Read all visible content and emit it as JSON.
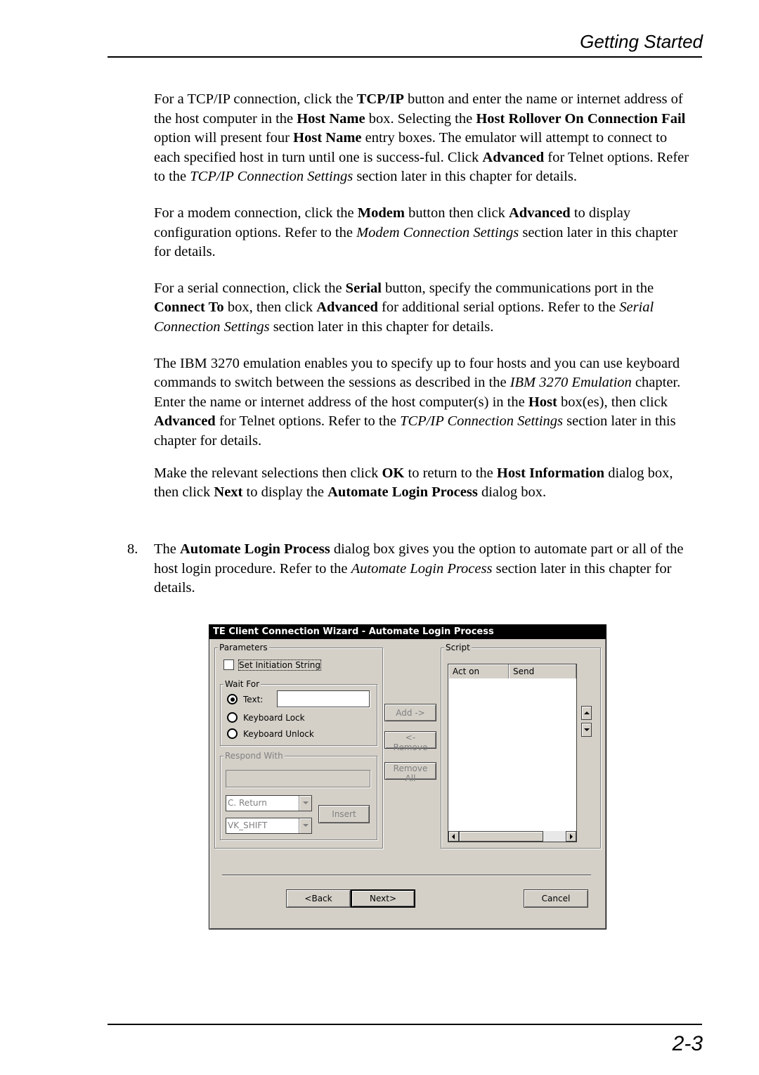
{
  "header": {
    "running_head": "Getting Started"
  },
  "paragraphs": [
    [
      "For a TCP/IP connection, click the ",
      {
        "b": "TCP/IP"
      },
      " button and enter the name or internet address of the host computer in the ",
      {
        "b": "Host Name"
      },
      " box. Selecting the ",
      {
        "b": "Host Rollover On Connection Fail"
      },
      " option will present four ",
      {
        "b": "Host Name"
      },
      " entry boxes. The emulator will attempt to connect to each specified host in turn until one is success-ful. Click ",
      {
        "b": "Advanced"
      },
      " for Telnet options. Refer to the ",
      {
        "i": "TCP/IP Connection Settings"
      },
      " section later in this chapter for details."
    ],
    [
      "For a modem connection, click the ",
      {
        "b": "Modem"
      },
      " button then click ",
      {
        "b": "Advanced"
      },
      " to display configuration options. Refer to the ",
      {
        "i": "Modem Connection Settings"
      },
      " section later in this chapter for details."
    ],
    [
      "For a serial connection, click the ",
      {
        "b": "Serial"
      },
      " button, specify the communications port in the ",
      {
        "b": "Connect To"
      },
      " box, then click ",
      {
        "b": "Advanced"
      },
      " for additional serial options. Refer to the ",
      {
        "i": "Serial Connection Settings"
      },
      " section later in this chapter for details."
    ],
    [
      "The IBM 3270 emulation enables you to specify up to four hosts and you can use keyboard commands to switch between the sessions as described in the ",
      {
        "i": "IBM 3270 Emulation"
      },
      " chapter. Enter the name or internet address of the host computer(s) in the ",
      {
        "b": "Host"
      },
      " box(es), then click ",
      {
        "b": "Advanced"
      },
      " for Telnet options. Refer to the ",
      {
        "i": "TCP/IP Connection Settings"
      },
      " section later in this chapter for details."
    ],
    [
      "Make the relevant selections then click ",
      {
        "b": "OK"
      },
      " to return to the ",
      {
        "b": "Host Information"
      },
      " dialog box, then click ",
      {
        "b": "Next"
      },
      " to display the ",
      {
        "b": "Automate Login Process"
      },
      " dialog box."
    ]
  ],
  "step": {
    "number": "8.",
    "content": [
      "The ",
      {
        "b": "Automate Login Process"
      },
      " dialog box gives you the option to automate part or all of the host login procedure. Refer to the ",
      {
        "i": "Automate Login Process"
      },
      " section later in this chapter for details."
    ]
  },
  "dialog": {
    "title": "TE Client Connection Wizard - Automate Login Process",
    "parameters_label": "Parameters",
    "set_initiation_string": "Set Initiation String",
    "set_initiation_checked": false,
    "wait_for_label": "Wait For",
    "radio_text": "Text:",
    "radio_keyboard_lock": "Keyboard Lock",
    "radio_keyboard_unlock": "Keyboard Unlock",
    "wait_for_selected": "Text",
    "text_value": "",
    "respond_with_label": "Respond With",
    "respond_value": "",
    "combo1_value": "C. Return",
    "combo2_value": "VK_SHIFT",
    "insert_button": "Insert",
    "add_button": "Add ->",
    "remove_button": "<- Remove",
    "remove_all_button": "Remove All",
    "script_label": "Script",
    "script_columns": [
      "Act on",
      "Send"
    ],
    "script_rows": [],
    "back_button": "<Back",
    "next_button": "Next>",
    "cancel_button": "Cancel"
  },
  "footer": {
    "page_number": "2-3"
  }
}
